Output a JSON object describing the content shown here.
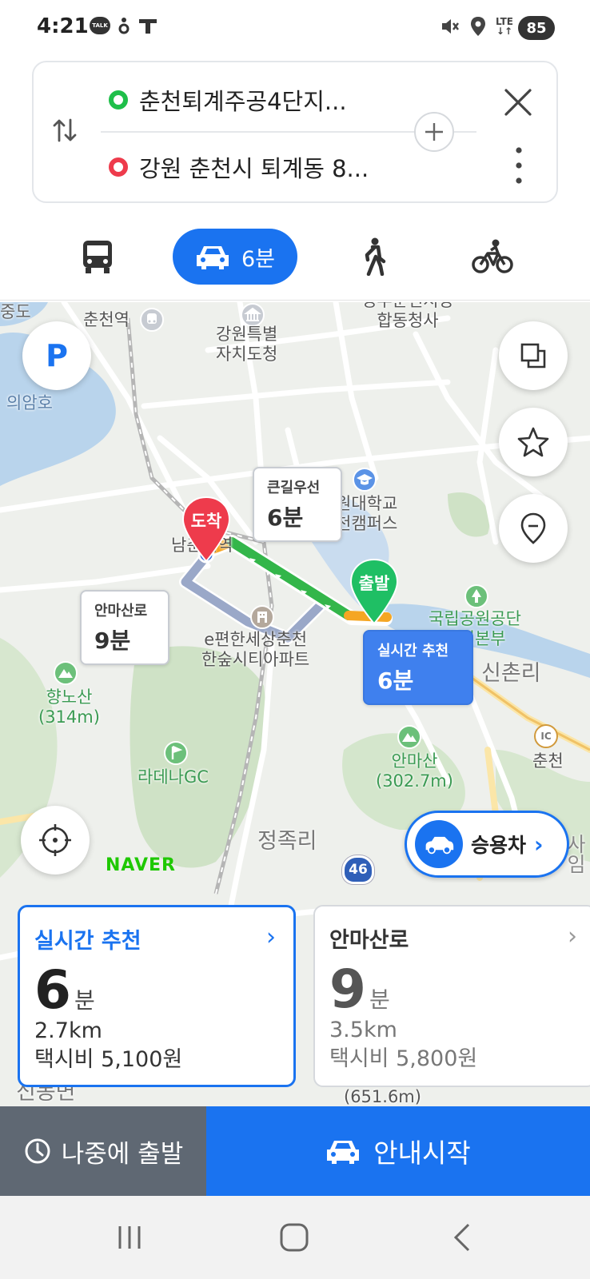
{
  "status_bar": {
    "time": "4:21",
    "talk_icon_text": "TALK",
    "network": "LTE",
    "battery": "85",
    "icons": [
      "talk-icon",
      "notification-icon",
      "t-icon",
      "mute-icon",
      "location-icon",
      "lte-icon",
      "signal-icon"
    ]
  },
  "route": {
    "origin": "춘천퇴계주공4단지...",
    "destination": "강원 춘천시 퇴계동 8...",
    "colors": {
      "origin": "#1fbf4a",
      "destination": "#ee3b4c"
    }
  },
  "modes": {
    "selected": "car",
    "car_time": "6분",
    "items": [
      "bus-icon",
      "car-icon",
      "walk-icon",
      "bike-icon"
    ]
  },
  "map": {
    "pois": {
      "jungdo": "중도",
      "chuncheon_station": "춘천역",
      "gangwon_office": "강원특별\n자치도청",
      "govt_building": "정부춘천지방\n합동청사",
      "uiam_lake": "의암호",
      "university": "원대학교\n천캠퍼스",
      "namchuncheon": "남춘천역",
      "apartment": "e편한세상춘천\n한숲시티아파트",
      "national_park": "국립공원공단\n지역본부",
      "sinchon": "신촌리",
      "hyangnosan": "향노산\n(314m)",
      "radena": "라데나GC",
      "anmasan": "안마산\n(302.7m)",
      "ic_label": "IC",
      "chuncheon_ic": "춘천",
      "jeongjok": "정족리",
      "route46": "46",
      "peak_bottom": "(651.6m)",
      "bottom_left": "신동면",
      "right_edge": "사임"
    },
    "pins": {
      "arrival": "도착",
      "departure": "출발"
    },
    "callouts": {
      "main_road": {
        "title": "큰길우선",
        "time": "6분"
      },
      "anmasan_road": {
        "title": "안마산로",
        "time": "9분"
      },
      "realtime": {
        "title": "실시간 추천",
        "time": "6분"
      }
    },
    "watermark": "NAVER",
    "vehicle_type": "승용차",
    "route_colors": {
      "traffic_green": "#33b64a",
      "traffic_orange": "#f5a623",
      "alt_route": "#9aa8c8"
    }
  },
  "options": [
    {
      "name": "실시간 추천",
      "duration": "6",
      "unit": "분",
      "distance": "2.7km",
      "taxi": "택시비 5,100원",
      "selected": true
    },
    {
      "name": "안마산로",
      "duration": "9",
      "unit": "분",
      "distance": "3.5km",
      "taxi": "택시비 5,800원",
      "selected": false
    }
  ],
  "actions": {
    "later": "나중에 출발",
    "start": "안내시작"
  },
  "brand_color": "#1a73f0"
}
